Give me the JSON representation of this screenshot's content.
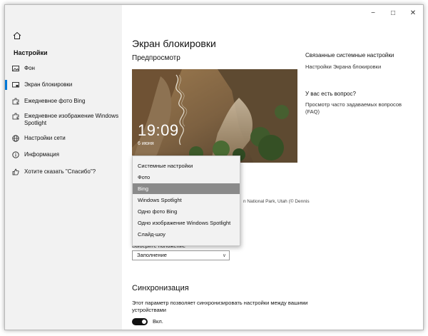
{
  "window": {
    "caption": {
      "minimize": "−",
      "maximize": "□",
      "close": "✕"
    }
  },
  "sidebar": {
    "home_icon": "home-icon",
    "title": "Настройки",
    "items": [
      {
        "label": "Фон",
        "icon": "picture-icon",
        "active": false
      },
      {
        "label": "Экран блокировки",
        "icon": "lockscreen-icon",
        "active": true
      },
      {
        "label": "Ежедневное фото Bing",
        "icon": "puzzle-icon",
        "active": false
      },
      {
        "label": "Ежедневное изображение Windows Spotlight",
        "icon": "puzzle-icon",
        "active": false
      },
      {
        "label": "Настройки сети",
        "icon": "globe-icon",
        "active": false
      },
      {
        "label": "Информация",
        "icon": "info-icon",
        "active": false
      },
      {
        "label": "Хотите сказать \"Спасибо\"?",
        "icon": "thumbs-up-icon",
        "active": false
      }
    ]
  },
  "main": {
    "page_title": "Экран блокировки",
    "preview_section_title": "Предпросмотр",
    "preview": {
      "time": "19:09",
      "date": "6 июня"
    },
    "background_dropdown": {
      "options": [
        "Системные настройки",
        "Фото",
        "Bing",
        "Windows Spotlight",
        "Одно фото Bing",
        "Одно изображение Windows Spotlight",
        "Слайд-шоу"
      ],
      "selected_index": 2
    },
    "credit_text": "n National Park, Utah (© Dennis",
    "position_label": "Выберите положение",
    "position_value": "Заполнение",
    "sync_title": "Синхронизация",
    "sync_description": "Этот параметр позволяет синхронизировать настройки между вашими устройствами",
    "sync_toggle_label": "Вкл.",
    "sync_toggle_on": true
  },
  "related": {
    "heading": "Связанные системные настройки",
    "link": "Настройки Экрана блокировки",
    "question_heading": "У вас есть вопрос?",
    "faq_link": "Просмотр часто задаваемых вопросов (FAQ)"
  },
  "colors": {
    "accent": "#0078d7",
    "sidebar_bg": "#f2f2f2",
    "selected_option": "#8a8a8a"
  }
}
